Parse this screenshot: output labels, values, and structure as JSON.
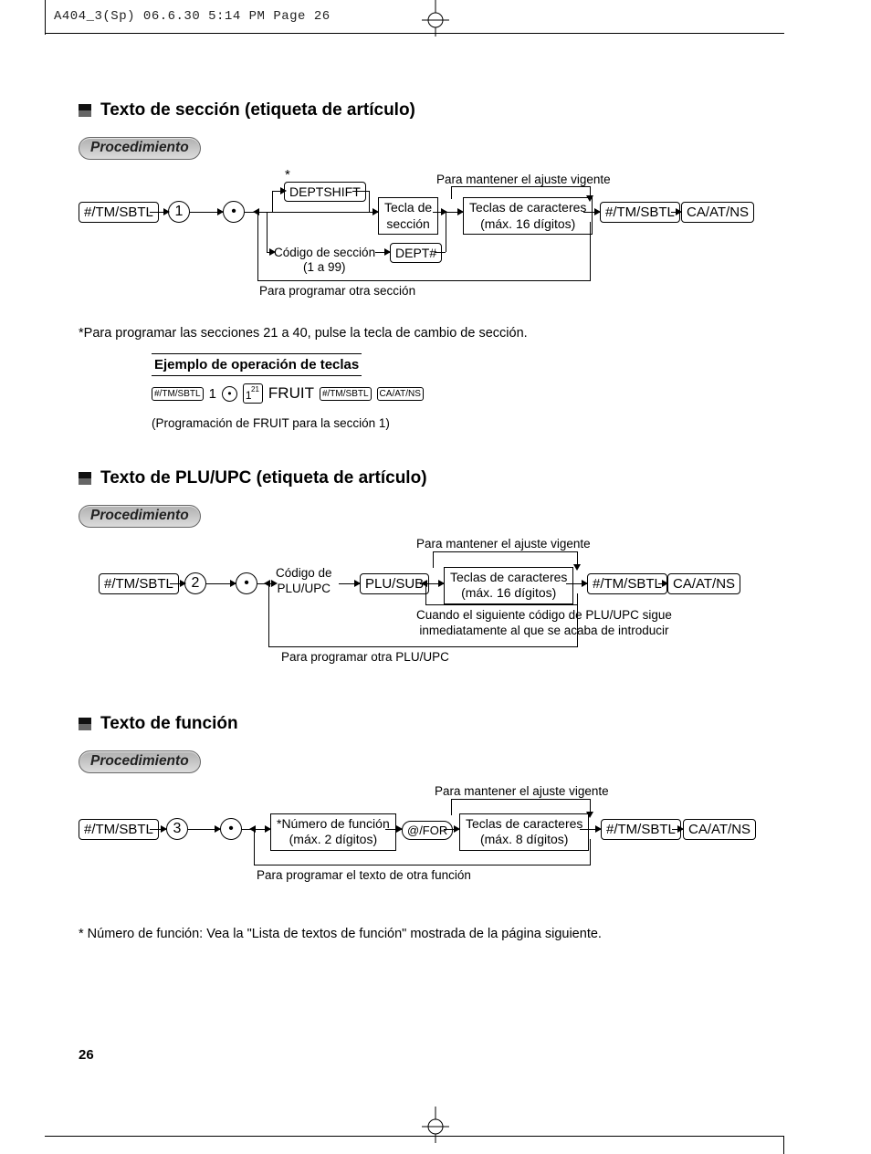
{
  "header": "A404_3(Sp)  06.6.30 5:14 PM  Page 26",
  "page_number": "26",
  "sec1": {
    "title": "Texto de sección (etiqueta de artículo)",
    "proc": "Procedimiento",
    "k_tmsbtl": "#/TM/SBTL",
    "k_1": "1",
    "k_dot": "•",
    "k_deptshift": "DEPTSHIFT",
    "lbl_tecla": "Tecla de\nsección",
    "lbl_caracteres": "Teclas de caracteres\n(máx. 16 dígitos)",
    "k_tmsbtl2": "#/TM/SBTL",
    "k_caatns": "CA/AT/NS",
    "lbl_codigo": "Código de sección",
    "lbl_rango": "(1 a 99)",
    "k_dept": "DEPT#",
    "lbl_mantener": "Para mantener el ajuste vigente",
    "lbl_otra": "Para programar otra sección",
    "star": "*",
    "foot": "*Para programar las secciones 21 a 40, pulse la tecla de cambio de sección.",
    "ex_head": "Ejemplo de operación de teclas",
    "ex_tmsbtl": "#/TM/SBTL",
    "ex_1": "1",
    "ex_dot": "•",
    "ex_key1": "1",
    "ex_key21": "21",
    "ex_fruit": "FRUIT",
    "ex_tmsbtl2": "#/TM/SBTL",
    "ex_caatns": "CA/AT/NS",
    "ex_note": "(Programación de FRUIT para la sección 1)"
  },
  "sec2": {
    "title": "Texto de PLU/UPC (etiqueta de artículo)",
    "proc": "Procedimiento",
    "k_tmsbtl": "#/TM/SBTL",
    "k_2": "2",
    "k_dot": "•",
    "lbl_codigo": "Código de\nPLU/UPC",
    "k_plusub": "PLU/SUB",
    "lbl_caracteres": "Teclas de caracteres\n(máx. 16 dígitos)",
    "k_tmsbtl2": "#/TM/SBTL",
    "k_caatns": "CA/AT/NS",
    "lbl_mantener": "Para mantener el ajuste vigente",
    "lbl_cuando": "Cuando el siguiente código de PLU/UPC sigue\ninmediatamente al que se acaba de introducir",
    "lbl_otra": "Para programar otra PLU/UPC"
  },
  "sec3": {
    "title": "Texto de función",
    "proc": "Procedimiento",
    "k_tmsbtl": "#/TM/SBTL",
    "k_3": "3",
    "k_dot": "•",
    "lbl_numfunc": "*Número de función\n(máx. 2 dígitos)",
    "k_for": "@/FOR",
    "lbl_caracteres": "Teclas de caracteres\n(máx. 8 dígitos)",
    "k_tmsbtl2": "#/TM/SBTL",
    "k_caatns": "CA/AT/NS",
    "lbl_mantener": "Para mantener el ajuste vigente",
    "lbl_otra": "Para programar el texto de otra función",
    "foot": "* Número de función: Vea la \"Lista de textos de función\" mostrada de la página siguiente."
  }
}
